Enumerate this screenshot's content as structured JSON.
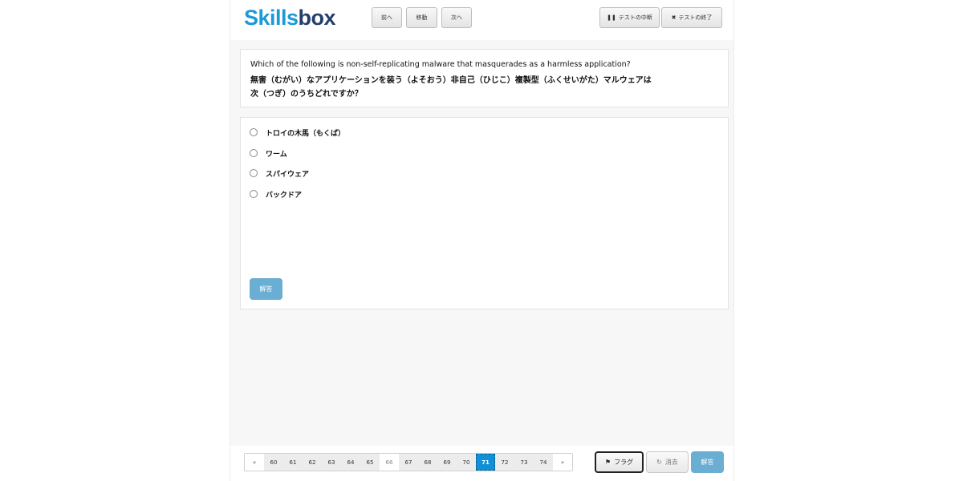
{
  "header": {
    "logo_part1": "Skills",
    "logo_part2": "box",
    "prev_label": "前へ",
    "move_label": "移動",
    "next_label": "次へ",
    "pause_label": "テストの中断",
    "end_label": "テストの終了"
  },
  "question": {
    "english": "Which of the following is non-self-replicating malware that masquerades as a harmless application?",
    "japanese_line1": "無害（むがい）なアプリケーションを装う（よそおう）非自己（ひじこ）複製型（ふくせいがた）マルウェアは",
    "japanese_line2": "次（つぎ）のうちどれですか？"
  },
  "options": [
    {
      "label": "トロイの木馬（もくば）"
    },
    {
      "label": "ワーム"
    },
    {
      "label": "スパイウェア"
    },
    {
      "label": "バックドア"
    }
  ],
  "answer_button_label": "解答",
  "pagination": {
    "prev": "«",
    "next": "»",
    "pages": [
      "60",
      "61",
      "62",
      "63",
      "64",
      "65",
      "66",
      "67",
      "68",
      "69",
      "70",
      "71",
      "72",
      "73",
      "74"
    ],
    "current": "71",
    "plain": "66"
  },
  "footer": {
    "flag_label": "フラグ",
    "clear_label": "消去",
    "answer_label": "解答"
  },
  "colors": {
    "accent": "#1190d8",
    "answer_button": "#6aaed3",
    "logo_blue": "#1b9ad6",
    "logo_dark": "#243f6b"
  }
}
